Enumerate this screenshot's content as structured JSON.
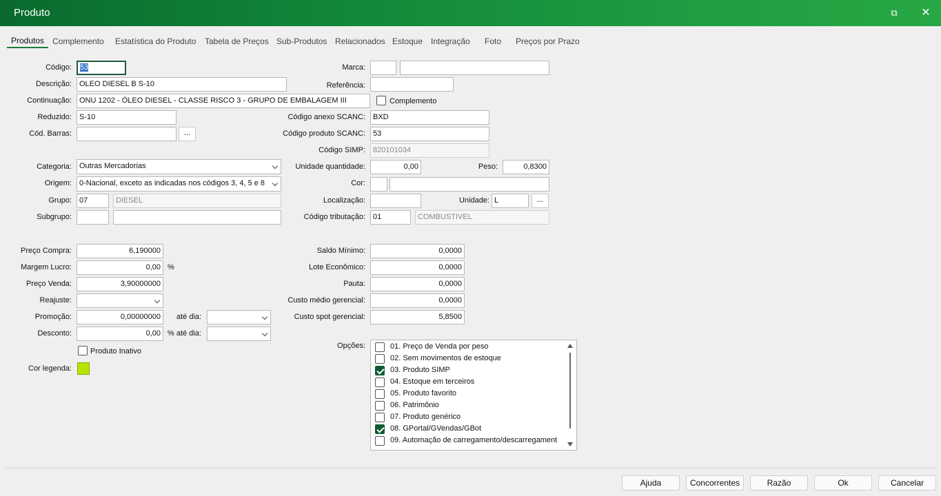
{
  "window": {
    "title": "Produto"
  },
  "tabs": [
    "Produtos",
    "Complemento",
    "Estatística do Produto",
    "Tabela de Preços",
    "Sub-Produtos",
    "Relacionados",
    "Estoque",
    "Integração",
    "Foto",
    "Preços por Prazo"
  ],
  "left": {
    "codigo_label": "Código:",
    "codigo": "53",
    "descricao_label": "Descrição:",
    "descricao": "OLEO DIESEL B S-10",
    "continuacao_label": "Continuação:",
    "continuacao": "ONU 1202 - ÓLEO DIESEL - CLASSE RISCO 3 - GRUPO DE EMBALAGEM III",
    "reduzido_label": "Reduzido:",
    "reduzido": "S-10",
    "cod_barras_label": "Cód. Barras:",
    "cod_barras": "",
    "categoria_label": "Categoria:",
    "categoria": "Outras Mercadorias",
    "origem_label": "Origem:",
    "origem": "0-Nacional, exceto as indicadas nos códigos 3, 4, 5 e 8",
    "grupo_label": "Grupo:",
    "grupo_code": "07",
    "grupo_name": "DIESEL",
    "subgrupo_label": "Subgrupo:",
    "subgrupo_code": "",
    "subgrupo_name": ""
  },
  "right": {
    "marca_label": "Marca:",
    "marca_code": "",
    "marca_name": "",
    "referencia_label": "Referência:",
    "referencia": "",
    "complemento_label": "Complemento",
    "cod_anexo_label": "Código anexo SCANC:",
    "cod_anexo": "BXD",
    "cod_produto_label": "Código produto SCANC:",
    "cod_produto": "53",
    "cod_simp_label": "Código SIMP:",
    "cod_simp": "820101034",
    "unidade_qtd_label": "Unidade quantidade:",
    "unidade_qtd": "0,00",
    "peso_label": "Peso:",
    "peso": "0,8300",
    "cor_label": "Cor:",
    "cor_code": "",
    "cor_name": "",
    "localizacao_label": "Localização:",
    "localizacao": "",
    "unidade_label": "Unidade:",
    "unidade": "L",
    "cod_trib_label": "Código tributação:",
    "cod_trib": "01",
    "cod_trib_name": "COMBUSTIVEL"
  },
  "pricing": {
    "preco_compra_label": "Preço Compra:",
    "preco_compra": "6,190000",
    "margem_label": "Margem Lucro:",
    "margem": "0,00",
    "margem_unit": "%",
    "preco_venda_label": "Preço Venda:",
    "preco_venda": "3,90000000",
    "reajuste_label": "Reajuste:",
    "reajuste": "",
    "promocao_label": "Promoção:",
    "promocao": "0,00000000",
    "ate_dia_label": "até dia:",
    "ate_dia": "",
    "desconto_label": "Desconto:",
    "desconto": "0,00",
    "pct_ate_dia_label": "% até dia:",
    "pct_ate_dia": "",
    "inativo_label": "Produto Inativo",
    "cor_legenda_label": "Cor legenda:",
    "legend_color": "#b7e400"
  },
  "stock": {
    "saldo_min_label": "Saldo Mínimo:",
    "saldo_min": "0,0000",
    "lote_label": "Lote Econômico:",
    "lote": "0,0000",
    "pauta_label": "Pauta:",
    "pauta": "0,0000",
    "custo_medio_label": "Custo médio gerencial:",
    "custo_medio": "0,0000",
    "custo_spot_label": "Custo spot gerencial:",
    "custo_spot": "5,8500"
  },
  "opcoes": {
    "label": "Opções:",
    "items": [
      {
        "text": "01. Preço de Venda por peso",
        "checked": false
      },
      {
        "text": "02. Sem movimentos de estoque",
        "checked": false
      },
      {
        "text": "03. Produto SIMP",
        "checked": true
      },
      {
        "text": "04. Estoque em terceiros",
        "checked": false
      },
      {
        "text": "05. Produto favorito",
        "checked": false
      },
      {
        "text": "06. Patrimônio",
        "checked": false
      },
      {
        "text": "07. Produto genérico",
        "checked": false
      },
      {
        "text": "08. GPortal/GVendas/GBot",
        "checked": true
      },
      {
        "text": "09. Automação de carregamento/descarregament",
        "checked": false
      }
    ]
  },
  "footer": {
    "ajuda": "Ajuda",
    "concorrentes": "Concorrentes",
    "razao": "Razão",
    "ok": "Ok",
    "cancelar": "Cancelar"
  },
  "ellipsis": "..."
}
